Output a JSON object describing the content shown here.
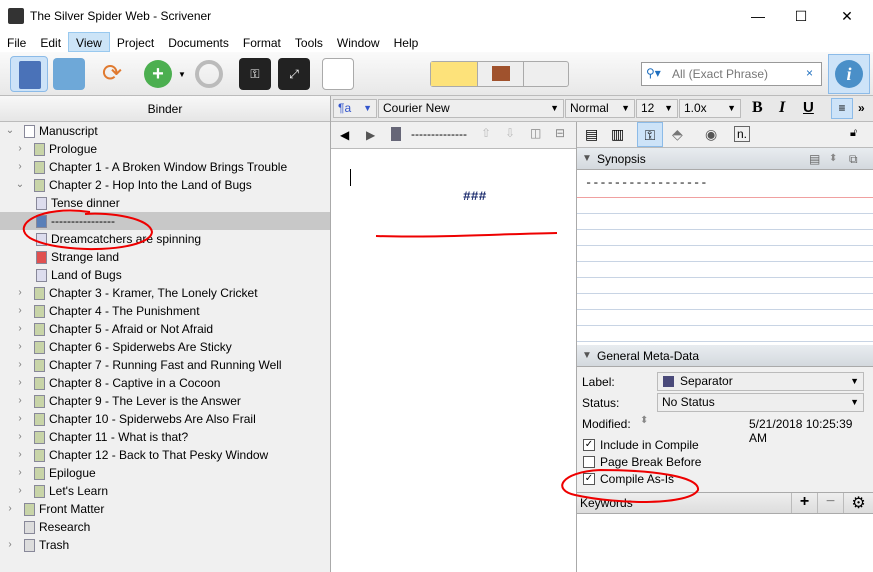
{
  "window": {
    "title": "The Silver Spider Web - Scrivener",
    "minimize": "—",
    "maximize": "☐",
    "close": "✕"
  },
  "menu": [
    "File",
    "Edit",
    "View",
    "Project",
    "Documents",
    "Format",
    "Tools",
    "Window",
    "Help"
  ],
  "search": {
    "placeholder": "All (Exact Phrase)",
    "clear": "×"
  },
  "binder": {
    "title": "Binder",
    "items": [
      {
        "label": "Manuscript",
        "level": 0,
        "chev": "⌄",
        "icon": "manuscript"
      },
      {
        "label": "Prologue",
        "level": 1,
        "chev": "›",
        "icon": "folder"
      },
      {
        "label": "Chapter 1 - A Broken Window Brings Trouble",
        "level": 1,
        "chev": "›",
        "icon": "folder"
      },
      {
        "label": "Chapter 2 - Hop Into the Land of Bugs",
        "level": 1,
        "chev": "⌄",
        "icon": "folder"
      },
      {
        "label": "Tense dinner",
        "level": 2,
        "icon": "doc"
      },
      {
        "label": "----------------",
        "level": 2,
        "icon": "doc-blue",
        "selected": true
      },
      {
        "label": "Dreamcatchers are spinning",
        "level": 2,
        "icon": "doc"
      },
      {
        "label": "Strange land",
        "level": 2,
        "icon": "doc-red"
      },
      {
        "label": "Land of Bugs",
        "level": 2,
        "icon": "doc"
      },
      {
        "label": "Chapter 3 - Kramer, The Lonely Cricket",
        "level": 1,
        "chev": "›",
        "icon": "folder"
      },
      {
        "label": "Chapter 4 - The Punishment",
        "level": 1,
        "chev": "›",
        "icon": "folder"
      },
      {
        "label": "Chapter 5 - Afraid or Not Afraid",
        "level": 1,
        "chev": "›",
        "icon": "folder"
      },
      {
        "label": "Chapter 6 - Spiderwebs Are Sticky",
        "level": 1,
        "chev": "›",
        "icon": "folder"
      },
      {
        "label": "Chapter 7 - Running Fast and Running Well",
        "level": 1,
        "chev": "›",
        "icon": "folder"
      },
      {
        "label": "Chapter 8 - Captive in a Cocoon",
        "level": 1,
        "chev": "›",
        "icon": "folder"
      },
      {
        "label": "Chapter 9 - The Lever is the Answer",
        "level": 1,
        "chev": "›",
        "icon": "folder"
      },
      {
        "label": "Chapter 10 - Spiderwebs Are Also Frail",
        "level": 1,
        "chev": "›",
        "icon": "folder"
      },
      {
        "label": "Chapter 11 - What is that?",
        "level": 1,
        "chev": "›",
        "icon": "folder"
      },
      {
        "label": "Chapter 12 - Back to That Pesky Window",
        "level": 1,
        "chev": "›",
        "icon": "folder"
      },
      {
        "label": "Epilogue",
        "level": 1,
        "chev": "›",
        "icon": "folder"
      },
      {
        "label": "Let's Learn",
        "level": 1,
        "chev": "›",
        "icon": "folder"
      },
      {
        "label": "Front Matter",
        "level": 0,
        "chev": "›",
        "icon": "folder"
      },
      {
        "label": "Research",
        "level": 0,
        "icon": "research"
      },
      {
        "label": "Trash",
        "level": 0,
        "chev": "›",
        "icon": "trash"
      }
    ]
  },
  "format": {
    "style": "¶a",
    "font": "Courier New",
    "weight": "Normal",
    "size": "12",
    "spacing": "1.0x",
    "bold": "B",
    "italic": "I",
    "underline": "U",
    "more": "»"
  },
  "nav": {
    "back": "◀",
    "forward": "▶",
    "doc_title": "--------------"
  },
  "editor": {
    "text": "###"
  },
  "inspector": {
    "synopsis_title": "Synopsis",
    "synopsis_text": "-----------------",
    "meta_title": "General Meta-Data",
    "label_label": "Label:",
    "label_value": "Separator",
    "label_color": "#4a4a7a",
    "status_label": "Status:",
    "status_value": "No Status",
    "modified_label": "Modified:",
    "modified_value": "5/21/2018 10:25:39 AM",
    "checks": [
      {
        "label": "Include in Compile",
        "checked": true
      },
      {
        "label": "Page Break Before",
        "checked": false
      },
      {
        "label": "Compile As-Is",
        "checked": true
      }
    ],
    "keywords_title": "Keywords",
    "add": "+",
    "remove": "−"
  }
}
